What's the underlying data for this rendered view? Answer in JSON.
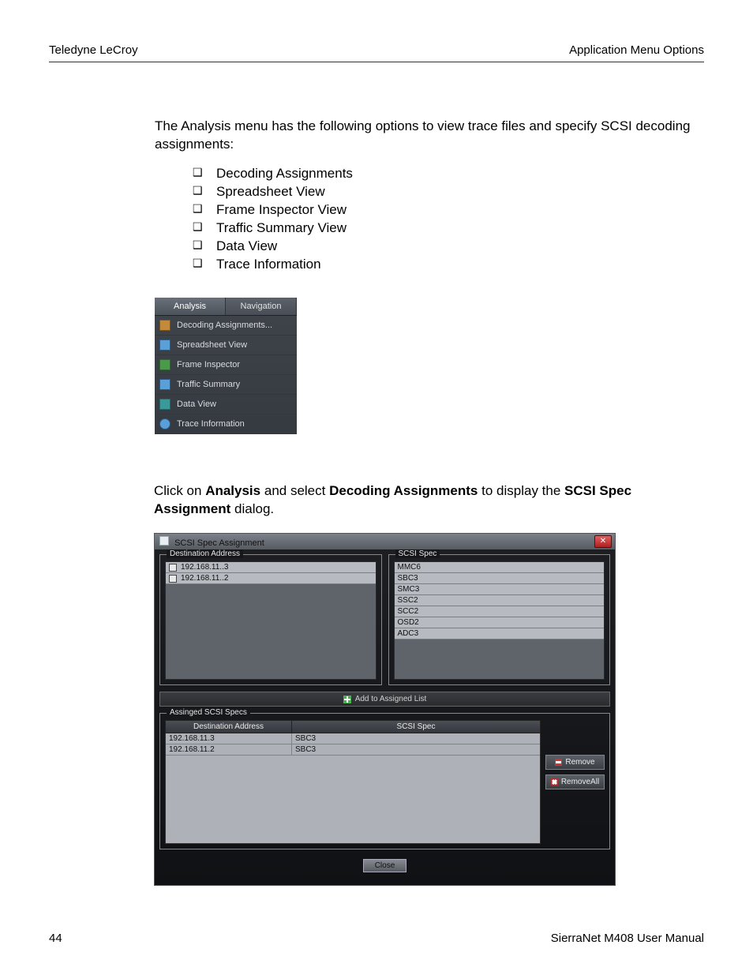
{
  "header": {
    "left": "Teledyne LeCroy",
    "right": "Application Menu Options"
  },
  "intro": "The Analysis menu has the following options to view trace files and specify SCSI decoding assignments:",
  "options": [
    "Decoding Assignments",
    "Spreadsheet View",
    "Frame Inspector View",
    "Traffic Summary View",
    "Data View",
    "Trace Information"
  ],
  "menu": {
    "tabs": [
      "Analysis",
      "Navigation"
    ],
    "items": [
      "Decoding Assignments...",
      "Spreadsheet View",
      "Frame Inspector",
      "Traffic Summary",
      "Data View",
      "Trace Information"
    ]
  },
  "instruction": {
    "pre": "Click on ",
    "b1": "Analysis",
    "mid1": " and select ",
    "b2": "Decoding Assignments",
    "mid2": " to display the ",
    "b3": "SCSI Spec Assignment",
    "post": " dialog."
  },
  "dialog": {
    "title": "SCSI Spec Assignment",
    "destLegend": "Destination Address",
    "specLegend": "SCSI Spec",
    "destList": [
      "192.168.11..3",
      "192.168.11..2"
    ],
    "specList": [
      "MMC6",
      "SBC3",
      "SMC3",
      "SSC2",
      "SCC2",
      "OSD2",
      "ADC3"
    ],
    "addLabel": "Add to Assigned List",
    "assignedLegend": "Assinged SCSI Specs",
    "colDest": "Destination Address",
    "colSpec": "SCSI Spec",
    "assigned": [
      {
        "dest": "192.168.11.3",
        "spec": "SBC3"
      },
      {
        "dest": "192.168.11.2",
        "spec": "SBC3"
      }
    ],
    "removeLabel": "Remove",
    "removeAllLabel": "RemoveAll",
    "closeLabel": "Close"
  },
  "footer": {
    "left": "44",
    "right": "SierraNet M408 User Manual"
  }
}
